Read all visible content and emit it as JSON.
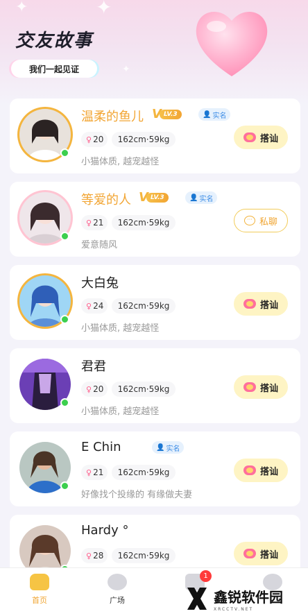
{
  "header": {
    "title": "交友故事",
    "subtitle": "我们一起见证"
  },
  "users": [
    {
      "name": "温柔的鱼儿",
      "vip": true,
      "level": "LV.3",
      "verified": true,
      "verified_label": "实名",
      "age": "20",
      "height_weight": "162cm·59kg",
      "bio": "小猫体质, 越宠越怪",
      "action": "搭讪",
      "action_type": "greet",
      "online": true
    },
    {
      "name": "等爱的人",
      "vip": true,
      "level": "LV.3",
      "verified": true,
      "verified_label": "实名",
      "age": "21",
      "height_weight": "162cm·59kg",
      "bio": "爱意随风",
      "action": "私聊",
      "action_type": "chat",
      "online": true
    },
    {
      "name": "大白兔",
      "vip": false,
      "verified": false,
      "age": "24",
      "height_weight": "162cm·59kg",
      "bio": "小猫体质, 越宠越怪",
      "action": "搭讪",
      "action_type": "greet",
      "online": true
    },
    {
      "name": "君君",
      "vip": false,
      "verified": false,
      "age": "20",
      "height_weight": "162cm·59kg",
      "bio": "小猫体质, 越宠越怪",
      "action": "搭讪",
      "action_type": "greet",
      "online": true
    },
    {
      "name": "E Chin",
      "vip": false,
      "verified": true,
      "verified_label": "实名",
      "age": "21",
      "height_weight": "162cm·59kg",
      "bio": "好像找个投缘的 有缘做夫妻",
      "action": "搭讪",
      "action_type": "greet",
      "online": true
    },
    {
      "name": "Hardy °",
      "vip": false,
      "verified": false,
      "age": "28",
      "height_weight": "162cm·59kg",
      "bio": "",
      "action": "搭讪",
      "action_type": "greet",
      "online": true
    }
  ],
  "tabbar": {
    "home_label": "首页",
    "plaza_label": "广场",
    "message_badge": "1"
  },
  "watermark": {
    "name": "鑫锐软件园",
    "url": "XRCCTV.NET"
  },
  "colors": {
    "vip_name": "#f2a533",
    "greet_button": "#fef4c4",
    "online": "#3ccf4e",
    "verified": "#3f8ee6"
  }
}
